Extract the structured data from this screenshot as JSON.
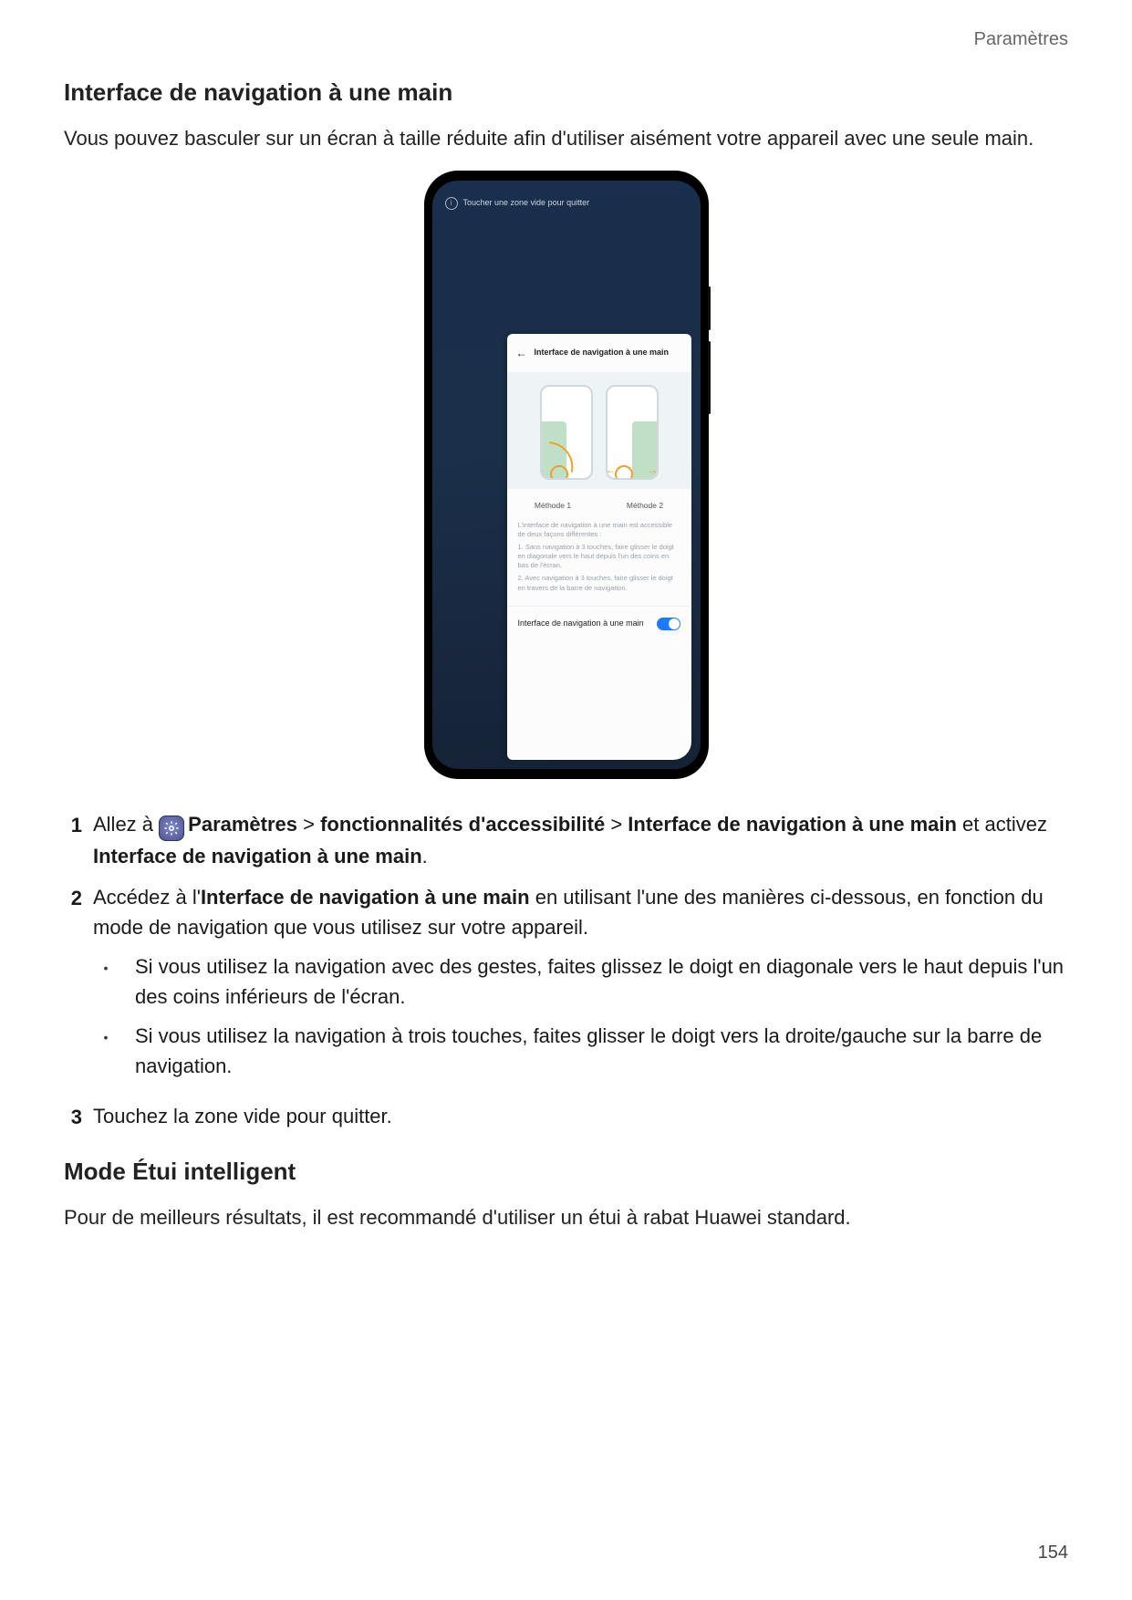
{
  "header": {
    "section": "Paramètres"
  },
  "h1": "Interface de navigation à une main",
  "intro": "Vous pouvez basculer sur un écran à taille réduite afin d'utiliser aisément votre appareil avec une seule main.",
  "phone": {
    "exit_tip": "Toucher une zone vide pour quitter",
    "panel_title": "Interface de navigation à une main",
    "method1": "Méthode 1",
    "method2": "Méthode 2",
    "explain_intro": "L'interface de navigation à une main est accessible de deux façons différentes :",
    "explain_1": "1. Sans navigation à 3 touches, faire glisser le doigt en diagonale vers le haut depuis l'un des coins en bas de l'écran.",
    "explain_2": "2. Avec navigation à 3 touches, faire glisser le doigt en travers de la barre de navigation.",
    "toggle_label": "Interface de navigation à une main"
  },
  "steps": {
    "n1": "1",
    "s1_a": "Allez à ",
    "s1_settings": "Paramètres",
    "s1_gt1": " > ",
    "s1_access": "fonctionnalités d'accessibilité",
    "s1_gt2": " > ",
    "s1_onehand": "Interface de navigation à une main",
    "s1_b": " et activez ",
    "s1_onehand2": "Interface de navigation à une main",
    "s1_c": ".",
    "n2": "2",
    "s2_a": "Accédez à l'",
    "s2_onehand": "Interface de navigation à une main",
    "s2_b": " en utilisant l'une des manières ci-dessous, en fonction du mode de navigation que vous utilisez sur votre appareil.",
    "s2_bullet1": "Si vous utilisez la navigation avec des gestes, faites glissez le doigt en diagonale vers le haut depuis l'un des coins inférieurs de l'écran.",
    "s2_bullet2": "Si vous utilisez la navigation à trois touches, faites glisser le doigt vers la droite/gauche sur la barre de navigation.",
    "n3": "3",
    "s3": "Touchez la zone vide pour quitter."
  },
  "h2": "Mode Étui intelligent",
  "p2": "Pour de meilleurs résultats, il est recommandé d'utiliser un étui à rabat Huawei standard.",
  "page_number": "154"
}
